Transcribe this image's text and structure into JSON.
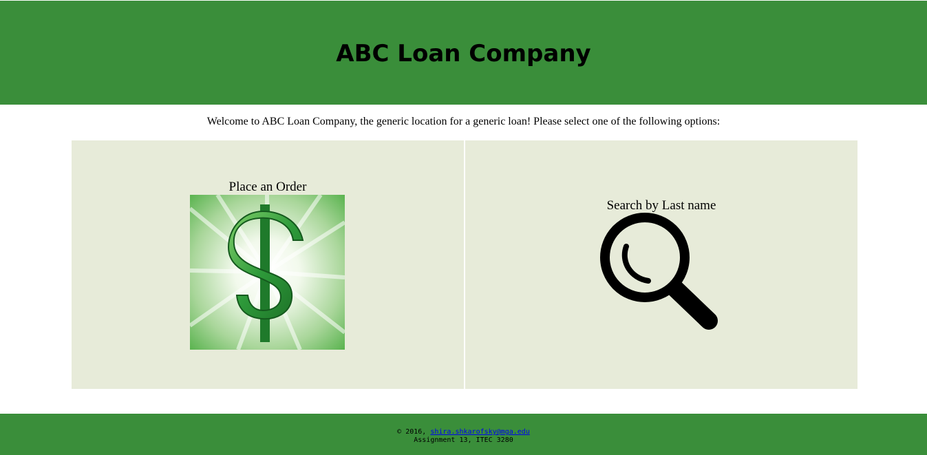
{
  "header": {
    "title": "ABC Loan Company"
  },
  "welcome": {
    "text": "Welcome to ABC Loan Company, the generic location for a generic loan! Please select one of the following options:"
  },
  "options": [
    {
      "label": "Place an Order",
      "icon": "dollar-sign-icon"
    },
    {
      "label": "Search by Last name",
      "icon": "magnifying-glass-icon"
    }
  ],
  "footer": {
    "copyright": "© 2016,",
    "email": "shira.shkarofsky@mga.edu",
    "assignment": "Assignment 13, ITEC 3280"
  },
  "colors": {
    "brand_green": "#3a8e3a",
    "panel_bg": "#e7ebd9",
    "link": "#0000ee"
  }
}
